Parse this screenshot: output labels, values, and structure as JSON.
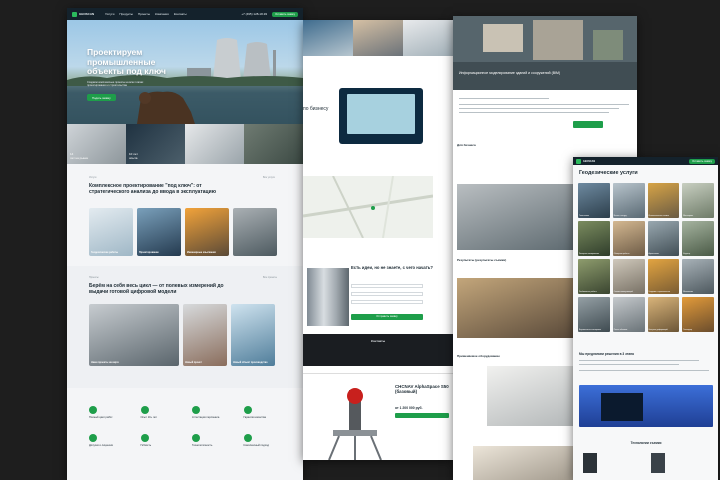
{
  "site": {
    "logo": "GEOSCAN",
    "nav": [
      "Услуги",
      "Продукты",
      "Проекты",
      "Компания",
      "Контакты"
    ],
    "phone": "+7 (495) 128-18-93",
    "cta_button": "Оставить заявку"
  },
  "screen1": {
    "hero_title": "Проектируем промышленные объекты под ключ",
    "hero_subtitle": "Создаём комплексные проекты на всех этапах проектирования и строительства",
    "hero_button": "Подать заявку",
    "stats": [
      {
        "value": "14",
        "label": "лет на рынке"
      },
      {
        "value": "10 лет",
        "label": "опыта"
      },
      {
        "value": "",
        "label": ""
      },
      {
        "value": "",
        "label": ""
      }
    ],
    "section1_label": "Услуги",
    "section1_link": "Все услуги",
    "section1_title": "Комплексное проектирование \"под ключ\": от стратегического анализа до ввода в эксплуатацию",
    "section1_cards": [
      "Геодезические работы",
      "Проектирование",
      "Инженерные изыскания",
      ""
    ],
    "section2_label": "Проекты",
    "section2_link": "Все проекты",
    "section2_title": "Берём на себя весь цикл — от полевых измерений до выдачи готовой цифровой модели",
    "section2_cards": [
      "Наши проекты на карте",
      "Новый проект",
      "Новый объект производство"
    ],
    "features": [
      "Полный цикл работ",
      "Опыт 10+ лет",
      "Аттестация персонала",
      "Гарантия качества",
      "Допуски и лицензии",
      "Гибкость",
      "Технологичность",
      "Комплексный подход"
    ]
  },
  "screen2": {
    "top_heading": "по бизнесу",
    "form_title": "Есть идеи, но не знаете, с чего начать?",
    "form_button": "Отправить заявку",
    "footer_heading": "Контакты",
    "product_title": "CHCNAV AlphaSpace S50 (базовый)",
    "product_price": "от 1 200 000 руб."
  },
  "screen3": {
    "hero_title": "Информационное моделирование зданий и сооружений (BIM)",
    "section_a": "Для бизнеса",
    "section_b": "Результаты (результаты съёмки)",
    "section_c": "Применяемое оборудование"
  },
  "screen4": {
    "title": "Геодезические услуги",
    "section_heading": "Мы предлагаем решения в 3 этапа",
    "tech_heading": "Технологии съемки",
    "gallery_labels": [
      "Топосъемка",
      "Вынос в натуру",
      "Исполнительная съемка",
      "Мониторинг",
      "Лазерное сканирование",
      "Обмерные работы",
      "Аэросъемка",
      "Кадастр",
      "Разбивочные работы",
      "Съемка коммуникаций",
      "Геодезия в строительстве",
      "Межевание",
      "Вертикальная планировка",
      "Расчет объемов",
      "Контроль деформаций",
      "Технадзор"
    ]
  }
}
